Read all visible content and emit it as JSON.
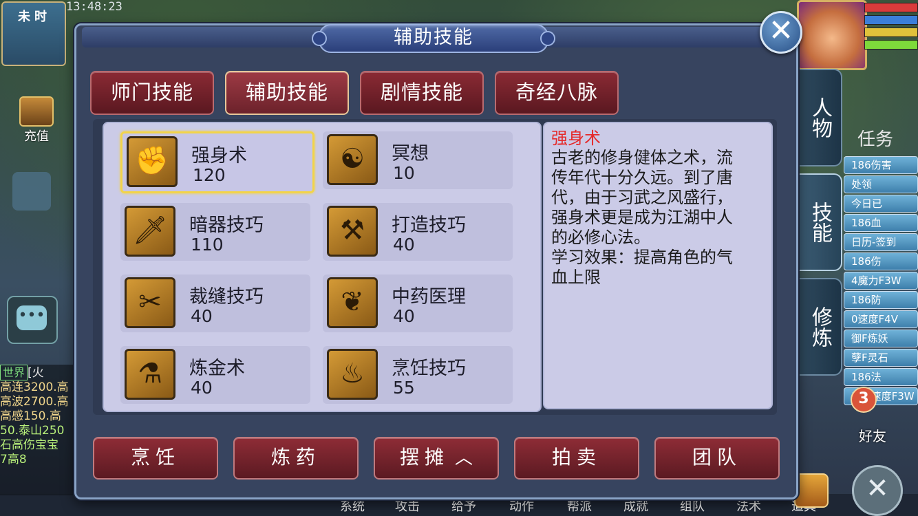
{
  "hud": {
    "time_label": "未时",
    "clock": "13:48:23",
    "recharge": "充值",
    "friends_badge": "3",
    "friends_label": "好友",
    "task_label": "任务"
  },
  "chat": {
    "channel": "世界",
    "prefix": "[火",
    "lines": [
      "高连3200.高",
      "高波2700.高",
      "高感150.高",
      "50.泰山250",
      "石高伤宝宝",
      "7高8"
    ]
  },
  "right_list": {
    "rows": [
      "186伤害",
      "处领",
      "今日已",
      "186血",
      "日历-签到",
      "186伤",
      "4魔力F3W",
      "186防",
      "0速度F4V",
      "御F炼妖",
      "孽F灵石",
      "186法",
      "186速度F3W"
    ]
  },
  "side_tabs": [
    {
      "label": "人物"
    },
    {
      "label": "技能"
    },
    {
      "label": "修炼"
    }
  ],
  "bottom_menu": [
    "系统",
    "攻击",
    "给予",
    "动作",
    "帮派",
    "成就",
    "组队",
    "法术",
    "道具"
  ],
  "dialog": {
    "title": "辅助技能",
    "close": "✕",
    "tabs": [
      {
        "label": "师门技能"
      },
      {
        "label": "辅助技能"
      },
      {
        "label": "剧情技能"
      },
      {
        "label": "奇经八脉"
      }
    ],
    "skills": [
      {
        "name": "强身术",
        "level": "120",
        "icon": "fist-icon",
        "glyph": "✊"
      },
      {
        "name": "冥想",
        "level": "10",
        "icon": "meditation-icon",
        "glyph": "☯"
      },
      {
        "name": "暗器技巧",
        "level": "110",
        "icon": "dagger-icon",
        "glyph": "🗡"
      },
      {
        "name": "打造技巧",
        "level": "40",
        "icon": "hammer-icon",
        "glyph": "⚒"
      },
      {
        "name": "裁缝技巧",
        "level": "40",
        "icon": "scissors-icon",
        "glyph": "✂"
      },
      {
        "name": "中药医理",
        "level": "40",
        "icon": "herb-icon",
        "glyph": "❦"
      },
      {
        "name": "炼金术",
        "level": "40",
        "icon": "alchemy-icon",
        "glyph": "⚗"
      },
      {
        "name": "烹饪技巧",
        "level": "55",
        "icon": "cooking-icon",
        "glyph": "♨"
      }
    ],
    "description": {
      "title": "强身术",
      "lines": [
        "古老的修身健体之术，流",
        "传年代十分久远。到了唐",
        "代，由于习武之风盛行，",
        "强身术更是成为江湖中人",
        "的必修心法。",
        "学习效果：提高角色的气",
        "血上限"
      ]
    },
    "actions": [
      {
        "label": "烹饪"
      },
      {
        "label": "炼药"
      },
      {
        "label": "摆摊",
        "chevron": "︿"
      },
      {
        "label": "拍卖"
      },
      {
        "label": "团队"
      }
    ]
  },
  "colors": {
    "tab_red": "#6c222b",
    "panel_lavender": "#cbcbe7",
    "selected_gold": "#f2d44a",
    "desc_title_red": "#e52a2a"
  }
}
